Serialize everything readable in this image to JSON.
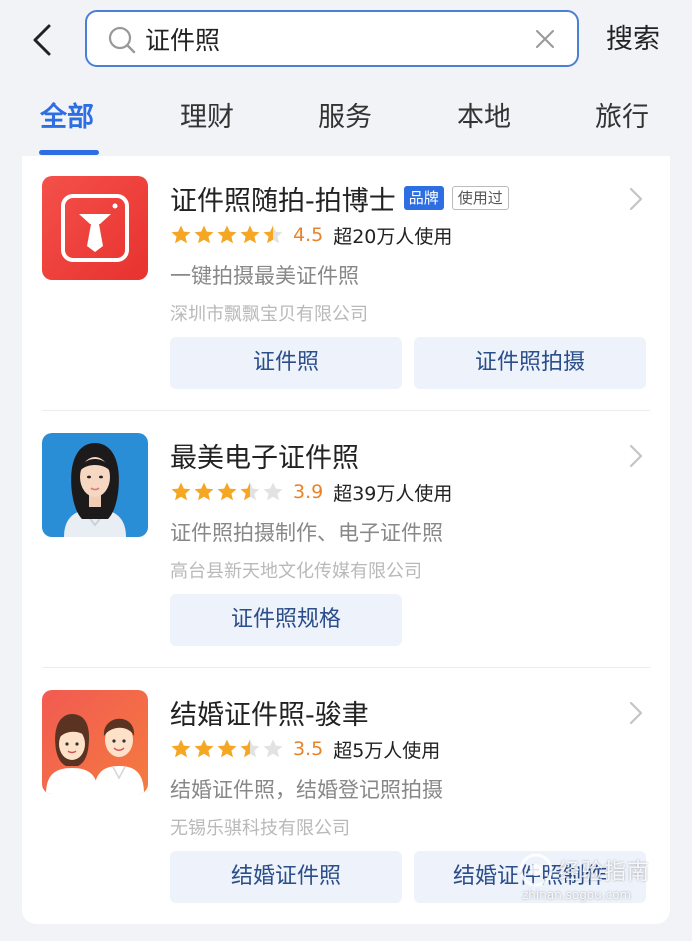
{
  "search": {
    "value": "证件照",
    "submit_label": "搜索"
  },
  "tabs": [
    {
      "label": "全部",
      "active": true
    },
    {
      "label": "理财",
      "active": false
    },
    {
      "label": "服务",
      "active": false
    },
    {
      "label": "本地",
      "active": false
    },
    {
      "label": "旅行",
      "active": false
    }
  ],
  "results": [
    {
      "title": "证件照随拍-拍博士",
      "badge_brand": "品牌",
      "badge_used": "使用过",
      "rating": "4.5",
      "stars": 4.5,
      "users": "超20万人使用",
      "description": "一键拍摄最美证件照",
      "company": "深圳市飘飘宝贝有限公司",
      "actions": [
        "证件照",
        "证件照拍摄"
      ],
      "icon": "tie-logo-icon"
    },
    {
      "title": "最美电子证件照",
      "rating": "3.9",
      "stars": 3.5,
      "users": "超39万人使用",
      "description": "证件照拍摄制作、电子证件照",
      "company": "高台县新天地文化传媒有限公司",
      "actions": [
        "证件照规格"
      ],
      "icon": "portrait-photo-icon"
    },
    {
      "title": "结婚证件照-骏聿",
      "rating": "3.5",
      "stars": 3.5,
      "users": "超5万人使用",
      "description": "结婚证件照，结婚登记照拍摄",
      "company": "无锡乐骐科技有限公司",
      "actions": [
        "结婚证件照",
        "结婚证件照制作"
      ],
      "icon": "couple-cartoon-icon"
    }
  ],
  "watermark": {
    "main": "经验指南",
    "sub": "zhinan.sogou.com"
  },
  "colors": {
    "accent": "#2d6fe3",
    "star": "#f5a623",
    "score": "#e8832a",
    "button_bg": "#edf2fb"
  }
}
